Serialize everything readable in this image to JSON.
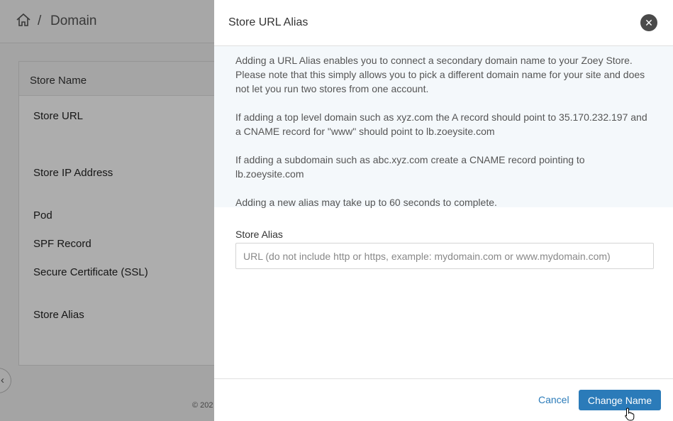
{
  "header": {
    "breadcrumb_sep": "/",
    "title": "Domain"
  },
  "card": {
    "header": "Store Name",
    "rows": [
      "Store URL",
      "Store IP Address",
      "Pod",
      "SPF Record",
      "Secure Certificate (SSL)",
      "Store Alias"
    ]
  },
  "footer": {
    "copyright": "© 202"
  },
  "drawer": {
    "title": "Store URL Alias",
    "info": [
      "Adding a URL Alias enables you to connect a secondary domain name to your Zoey Store. Please note that this simply allows you to pick a different domain name for your site and does not let you run two stores from one account.",
      "If adding a top level domain such as xyz.com the A record should point to 35.170.232.197 and a CNAME record for \"www\" should point to lb.zoeysite.com",
      "If adding a subdomain such as abc.xyz.com create a CNAME record pointing to lb.zoeysite.com",
      "Adding a new alias may take up to 60 seconds to complete."
    ],
    "field_label": "Store Alias",
    "field_value": "",
    "field_placeholder": "URL (do not include http or https, example: mydomain.com or www.mydomain.com)",
    "cancel_label": "Cancel",
    "submit_label": "Change Name"
  },
  "colors": {
    "accent": "#2b7bb9",
    "close_bg": "#4a4a4a",
    "info_bg": "#f4f8fb"
  },
  "icons": {
    "home": "home-icon",
    "close": "close-icon",
    "collapse": "chevron-left-icon",
    "cursor": "pointer-cursor-icon"
  }
}
